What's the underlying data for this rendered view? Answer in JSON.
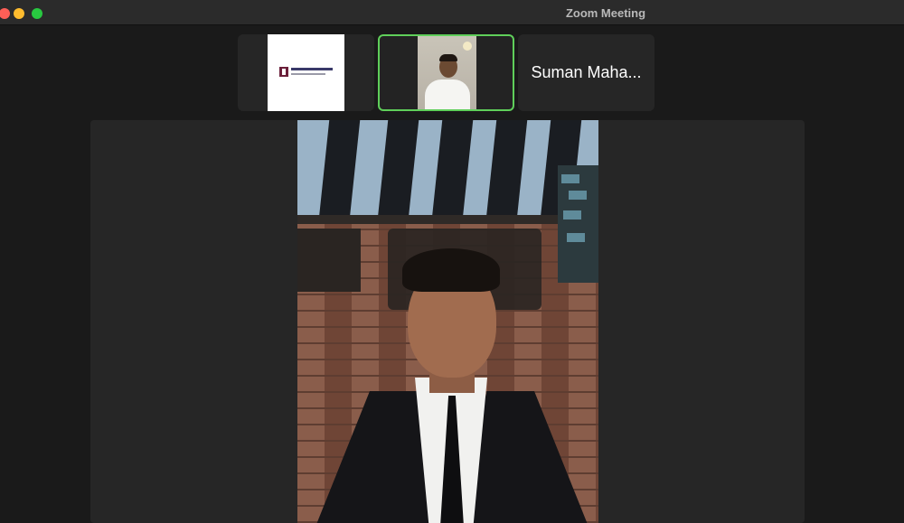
{
  "window": {
    "title": "Zoom Meeting"
  },
  "participants_strip": [
    {
      "name": "Suman Maha..."
    }
  ],
  "colors": {
    "active_speaker_border": "#5fcf5a",
    "titlebar": "#2b2b2b",
    "tile_bg": "#262626"
  },
  "icons": {
    "close": "traffic-light-close",
    "minimize": "traffic-light-minimize",
    "maximize": "traffic-light-maximize"
  }
}
